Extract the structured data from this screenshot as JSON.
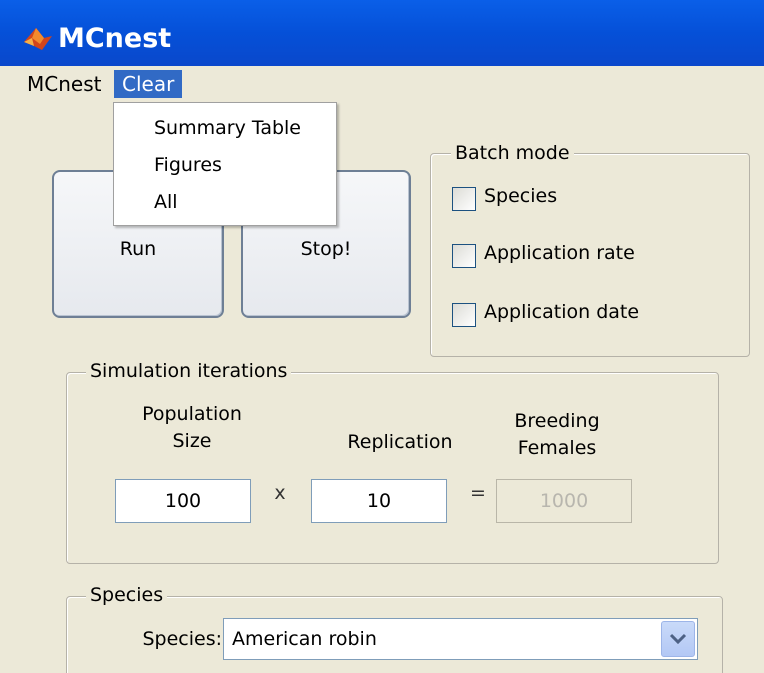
{
  "window": {
    "title": "MCnest",
    "icon": "matlab-logo-icon"
  },
  "menubar": {
    "items": [
      {
        "label": "MCnest"
      },
      {
        "label": "Clear"
      }
    ]
  },
  "clear_menu": {
    "items": [
      {
        "label": "Summary Table"
      },
      {
        "label": "Figures"
      },
      {
        "label": "All"
      }
    ]
  },
  "buttons": {
    "run_label": "Run",
    "stop_label": "Stop!"
  },
  "batch_mode": {
    "title": "Batch mode",
    "options": [
      {
        "label": "Species",
        "checked": false
      },
      {
        "label": "Application rate",
        "checked": false
      },
      {
        "label": "Application date",
        "checked": false
      }
    ]
  },
  "simulation": {
    "title": "Simulation iterations",
    "population_label_line1": "Population",
    "population_label_line2": "Size",
    "replication_label": "Replication",
    "breeding_label_line1": "Breeding",
    "breeding_label_line2": "Females",
    "population_value": "100",
    "times_symbol": "x",
    "replication_value": "10",
    "equals_symbol": "=",
    "breeding_value": "1000"
  },
  "species": {
    "title": "Species",
    "label": "Species:",
    "selected": "American robin"
  },
  "colors": {
    "titlebar": "#0550d8",
    "menu_highlight": "#316ac5",
    "panel_background": "#ece9d8"
  }
}
